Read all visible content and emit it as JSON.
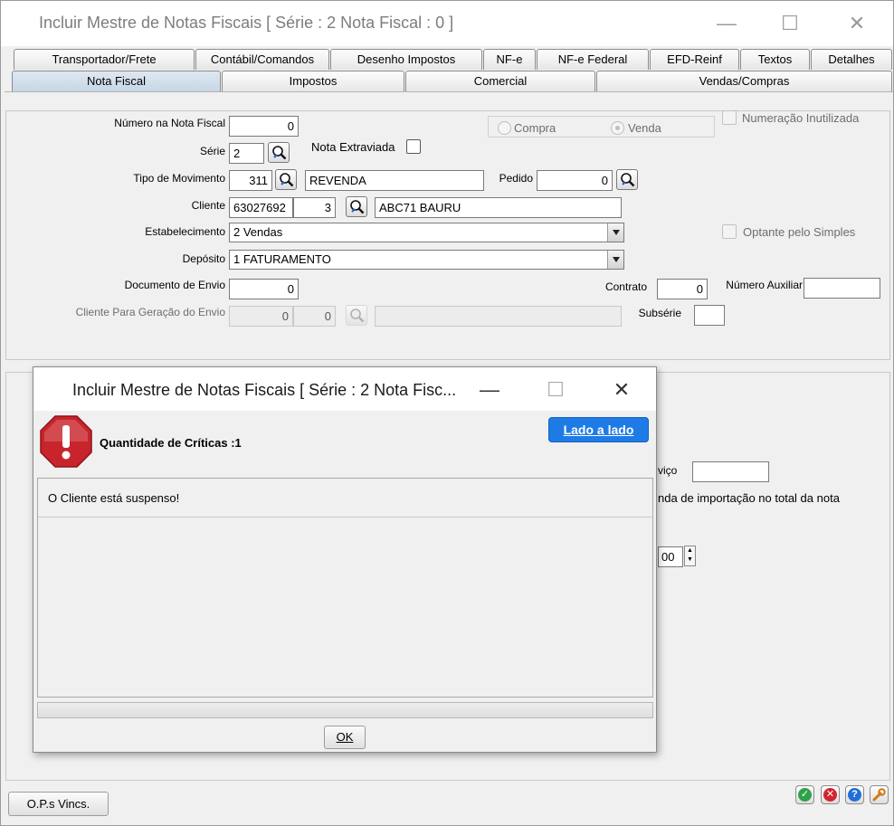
{
  "window": {
    "title": "Incluir Mestre de Notas Fiscais [ Série : 2 Nota Fiscal : 0 ]"
  },
  "tabs_row1": [
    "Transportador/Frete",
    "Contábil/Comandos",
    "Desenho Impostos",
    "NF-e",
    "NF-e Federal",
    "EFD-Reinf",
    "Textos",
    "Detalhes"
  ],
  "tabs_row2": [
    "Nota Fiscal",
    "Impostos",
    "Comercial",
    "Vendas/Compras"
  ],
  "form": {
    "numero_label": "Número na Nota Fiscal",
    "numero_value": "0",
    "serie_label": "Série",
    "serie_value": "2",
    "nota_extraviada_label": "Nota Extraviada",
    "compra_label": "Compra",
    "venda_label": "Venda",
    "numeracao_inutilizada_label": "Numeração Inutilizada",
    "tipo_mov_label": "Tipo de Movimento",
    "tipo_mov_code": "311",
    "tipo_mov_desc": "REVENDA",
    "pedido_label": "Pedido",
    "pedido_value": "0",
    "cliente_label": "Cliente",
    "cliente_code": "63027692",
    "cliente_seq": "3",
    "cliente_name": "ABC71 BAURU",
    "estabelecimento_label": "Estabelecimento",
    "estabelecimento_value": "2 Vendas",
    "optante_label": "Optante pelo Simples",
    "deposito_label": "Depósito",
    "deposito_value": "1 FATURAMENTO",
    "doc_envio_label": "Documento de Envio",
    "doc_envio_value": "0",
    "contrato_label": "Contrato",
    "contrato_value": "0",
    "num_aux_label": "Número Auxiliar",
    "num_aux_value": "",
    "cliente_envio_label": "Cliente Para Geração do Envio",
    "cliente_envio_code": "0",
    "cliente_envio_seq": "0",
    "subserie_label": "Subsérie",
    "subserie_value": ""
  },
  "background_partial": {
    "servico_partial": "viço",
    "importacao_partial": "nda de importação no total da nota",
    "spinner_value": "00"
  },
  "bottom": {
    "ops_button": "O.P.s Vincs."
  },
  "dialog": {
    "title": "Incluir Mestre de Notas Fiscais [ Série : 2 Nota Fisc...",
    "criticas_label": "Quantidade de Críticas :1",
    "lado_button": "Lado a lado",
    "message": "O Cliente está suspenso!",
    "ok_button": "OK"
  },
  "colors": {
    "accent_blue": "#1e7be6",
    "error_red": "#c8242b",
    "ok_green": "#2ea24b"
  }
}
